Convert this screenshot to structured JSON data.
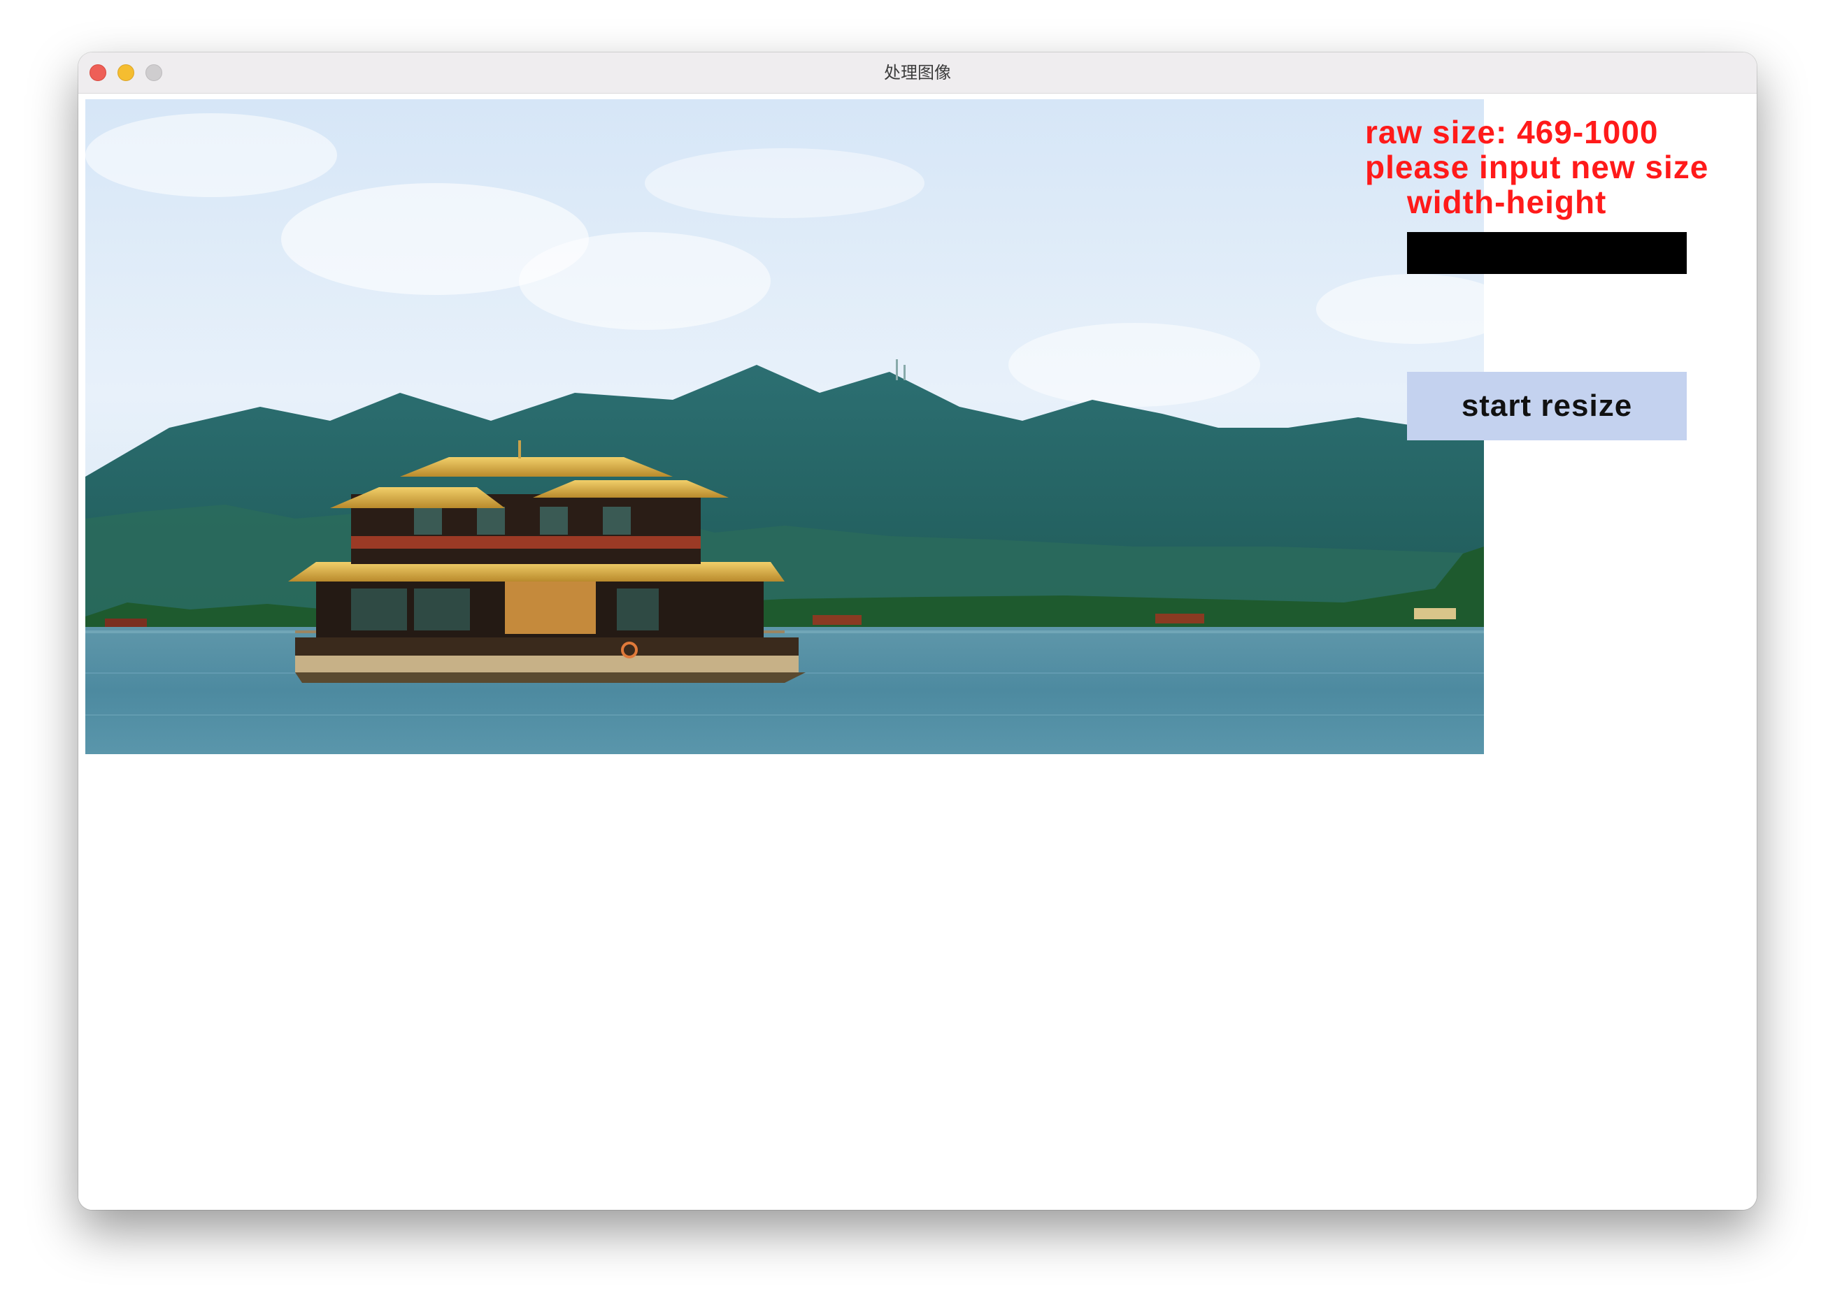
{
  "window": {
    "title": "处理图像"
  },
  "image": {
    "description_icon": "landscape-photo-icon"
  },
  "panel": {
    "raw_size_label": "raw size: 469-1000",
    "prompt_line1": "please input new size",
    "prompt_line2": "width-height",
    "size_input_value": "",
    "resize_button_label": "start resize"
  },
  "colors": {
    "label_text": "#ff1a1a",
    "input_bg": "#000000",
    "button_bg": "#c4d2ef"
  }
}
